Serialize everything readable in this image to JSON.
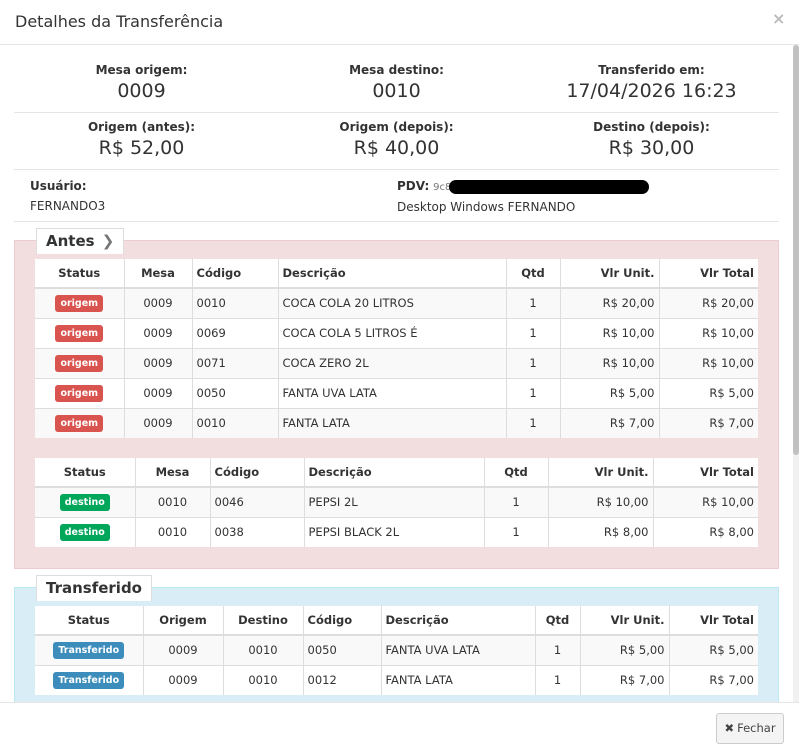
{
  "modal": {
    "title": "Detalhes da Transferência",
    "close_glyph": "×"
  },
  "summary": {
    "mesa_origem": {
      "label": "Mesa origem:",
      "value": "0009"
    },
    "mesa_destino": {
      "label": "Mesa destino:",
      "value": "0010"
    },
    "transferido_em": {
      "label": "Transferido em:",
      "value": "17/04/2026 16:23"
    },
    "origem_antes": {
      "label": "Origem (antes):",
      "value": "R$ 52,00"
    },
    "origem_depois": {
      "label": "Origem (depois):",
      "value": "R$ 40,00"
    },
    "destino_depois": {
      "label": "Destino (depois):",
      "value": "R$ 30,00"
    }
  },
  "usuario": {
    "label": "Usuário:",
    "value": "FERNANDO3"
  },
  "pdv": {
    "label": "PDV:",
    "id_prefix": "9c8",
    "value": "Desktop Windows FERNANDO"
  },
  "antes": {
    "legend": "Antes",
    "chevron_glyph": "❯",
    "origem_table": {
      "headers": [
        "Status",
        "Mesa",
        "Código",
        "Descrição",
        "Qtd",
        "Vlr Unit.",
        "Vlr Total"
      ],
      "rows": [
        {
          "status": "origem",
          "mesa": "0009",
          "codigo": "0010",
          "descricao": "COCA COLA 20 LITROS",
          "qtd": "1",
          "unit": "R$ 20,00",
          "total": "R$ 20,00"
        },
        {
          "status": "origem",
          "mesa": "0009",
          "codigo": "0069",
          "descricao": "COCA COLA 5 LITROS É",
          "qtd": "1",
          "unit": "R$ 10,00",
          "total": "R$ 10,00"
        },
        {
          "status": "origem",
          "mesa": "0009",
          "codigo": "0071",
          "descricao": "COCA ZERO 2L",
          "qtd": "1",
          "unit": "R$ 10,00",
          "total": "R$ 10,00"
        },
        {
          "status": "origem",
          "mesa": "0009",
          "codigo": "0050",
          "descricao": "FANTA UVA LATA",
          "qtd": "1",
          "unit": "R$ 5,00",
          "total": "R$ 5,00"
        },
        {
          "status": "origem",
          "mesa": "0009",
          "codigo": "0010",
          "descricao": "FANTA LATA",
          "qtd": "1",
          "unit": "R$ 7,00",
          "total": "R$ 7,00"
        }
      ]
    },
    "destino_table": {
      "headers": [
        "Status",
        "Mesa",
        "Código",
        "Descrição",
        "Qtd",
        "Vlr Unit.",
        "Vlr Total"
      ],
      "rows": [
        {
          "status": "destino",
          "mesa": "0010",
          "codigo": "0046",
          "descricao": "PEPSI 2L",
          "qtd": "1",
          "unit": "R$ 10,00",
          "total": "R$ 10,00"
        },
        {
          "status": "destino",
          "mesa": "0010",
          "codigo": "0038",
          "descricao": "PEPSI BLACK 2L",
          "qtd": "1",
          "unit": "R$ 8,00",
          "total": "R$ 8,00"
        }
      ]
    }
  },
  "transferido": {
    "legend": "Transferido",
    "table": {
      "headers": [
        "Status",
        "Origem",
        "Destino",
        "Código",
        "Descrição",
        "Qtd",
        "Vlr Unit.",
        "Vlr Total"
      ],
      "rows": [
        {
          "status": "Transferido",
          "origem": "0009",
          "destino": "0010",
          "codigo": "0050",
          "descricao": "FANTA UVA LATA",
          "qtd": "1",
          "unit": "R$ 5,00",
          "total": "R$ 5,00"
        },
        {
          "status": "Transferido",
          "origem": "0009",
          "destino": "0010",
          "codigo": "0012",
          "descricao": "FANTA LATA",
          "qtd": "1",
          "unit": "R$ 7,00",
          "total": "R$ 7,00"
        }
      ]
    }
  },
  "footer": {
    "close_glyph": "✖",
    "close_label": "Fechar"
  },
  "colors": {
    "origem": "#d9534f",
    "destino": "#00a65a",
    "transferido": "#3c8dbc",
    "panel_antes": "#f2dede",
    "panel_transferido": "#d9edf7"
  }
}
